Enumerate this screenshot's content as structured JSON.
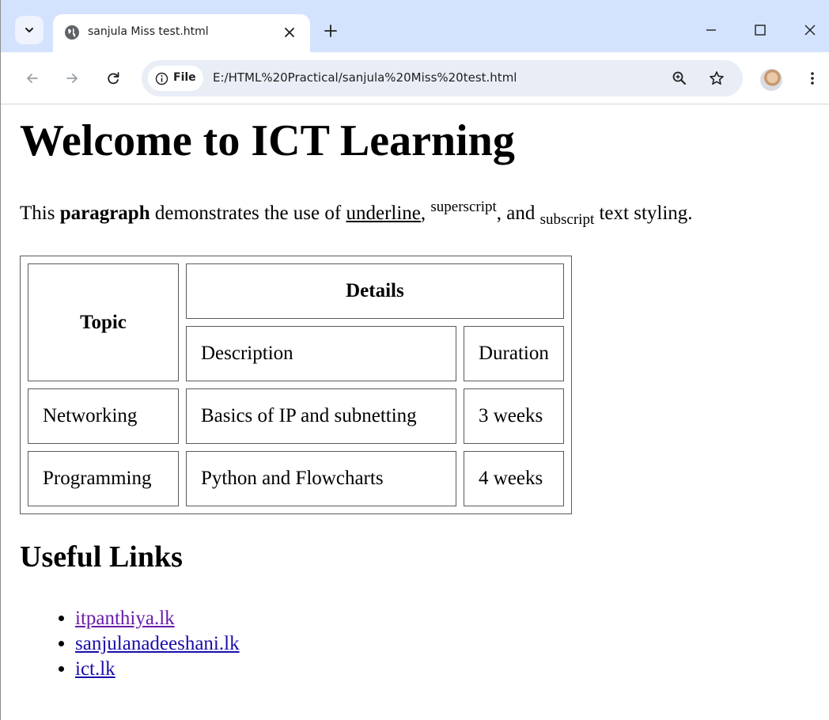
{
  "browser": {
    "tab": {
      "title": "sanjula Miss test.html"
    },
    "site_chip": "File",
    "url": "E:/HTML%20Practical/sanjula%20Miss%20test.html"
  },
  "page": {
    "heading": "Welcome to ICT Learning",
    "paragraph": {
      "text1": "This ",
      "bold": "paragraph",
      "text2": " demonstrates the use of ",
      "underline": "underline",
      "text3": ", ",
      "superscript": "superscript",
      "text4": ", and ",
      "subscript": "subscript",
      "text5": " text styling."
    },
    "table": {
      "header_topic": "Topic",
      "header_details": "Details",
      "header_description": "Description",
      "header_duration": "Duration",
      "rows": [
        {
          "topic": "Networking",
          "description": "Basics of IP and subnetting",
          "duration": "3 weeks"
        },
        {
          "topic": "Programming",
          "description": "Python and Flowcharts",
          "duration": "4 weeks"
        }
      ]
    },
    "links_heading": "Useful Links",
    "links": [
      {
        "label": "itpanthiya.lk",
        "visited": true
      },
      {
        "label": "sanjulanadeeshani.lk",
        "visited": false
      },
      {
        "label": "ict.lk",
        "visited": false
      }
    ],
    "colors": {
      "link": "#1a0dab",
      "visited_link": "#681da8",
      "tabstrip": "#d3e3fd"
    }
  }
}
